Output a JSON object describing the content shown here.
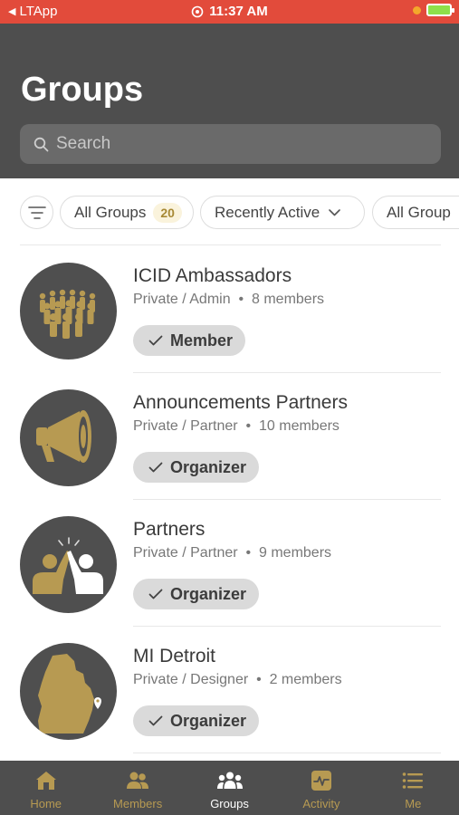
{
  "status_bar": {
    "back_label": "LTApp",
    "time": "11:37 AM"
  },
  "header": {
    "title": "Groups",
    "search_placeholder": "Search"
  },
  "filters": {
    "all_groups_label": "All Groups",
    "all_groups_count": "20",
    "recently_active_label": "Recently Active",
    "all_group_types_label": "All Group"
  },
  "groups": [
    {
      "name": "ICID Ambassadors",
      "visibility": "Private / Admin",
      "members": "8 members",
      "role": "Member",
      "icon": "crowd-icon"
    },
    {
      "name": "Announcements Partners",
      "visibility": "Private / Partner",
      "members": "10 members",
      "role": "Organizer",
      "icon": "megaphone-icon"
    },
    {
      "name": "Partners",
      "visibility": "Private / Partner",
      "members": "9 members",
      "role": "Organizer",
      "icon": "high-five-icon"
    },
    {
      "name": "MI Detroit",
      "visibility": "Private / Designer",
      "members": "2 members",
      "role": "Organizer",
      "icon": "michigan-map-icon"
    }
  ],
  "bottom_nav": {
    "items": [
      {
        "label": "Home",
        "icon": "home-icon"
      },
      {
        "label": "Members",
        "icon": "members-icon"
      },
      {
        "label": "Groups",
        "icon": "groups-icon",
        "active": true
      },
      {
        "label": "Activity",
        "icon": "activity-icon"
      },
      {
        "label": "Me",
        "icon": "menu-icon"
      }
    ]
  },
  "colors": {
    "status_bar": "#e24b3b",
    "header_bg": "#4e4e4e",
    "accent_gold": "#b79a52",
    "badge_bg": "#dadada"
  }
}
